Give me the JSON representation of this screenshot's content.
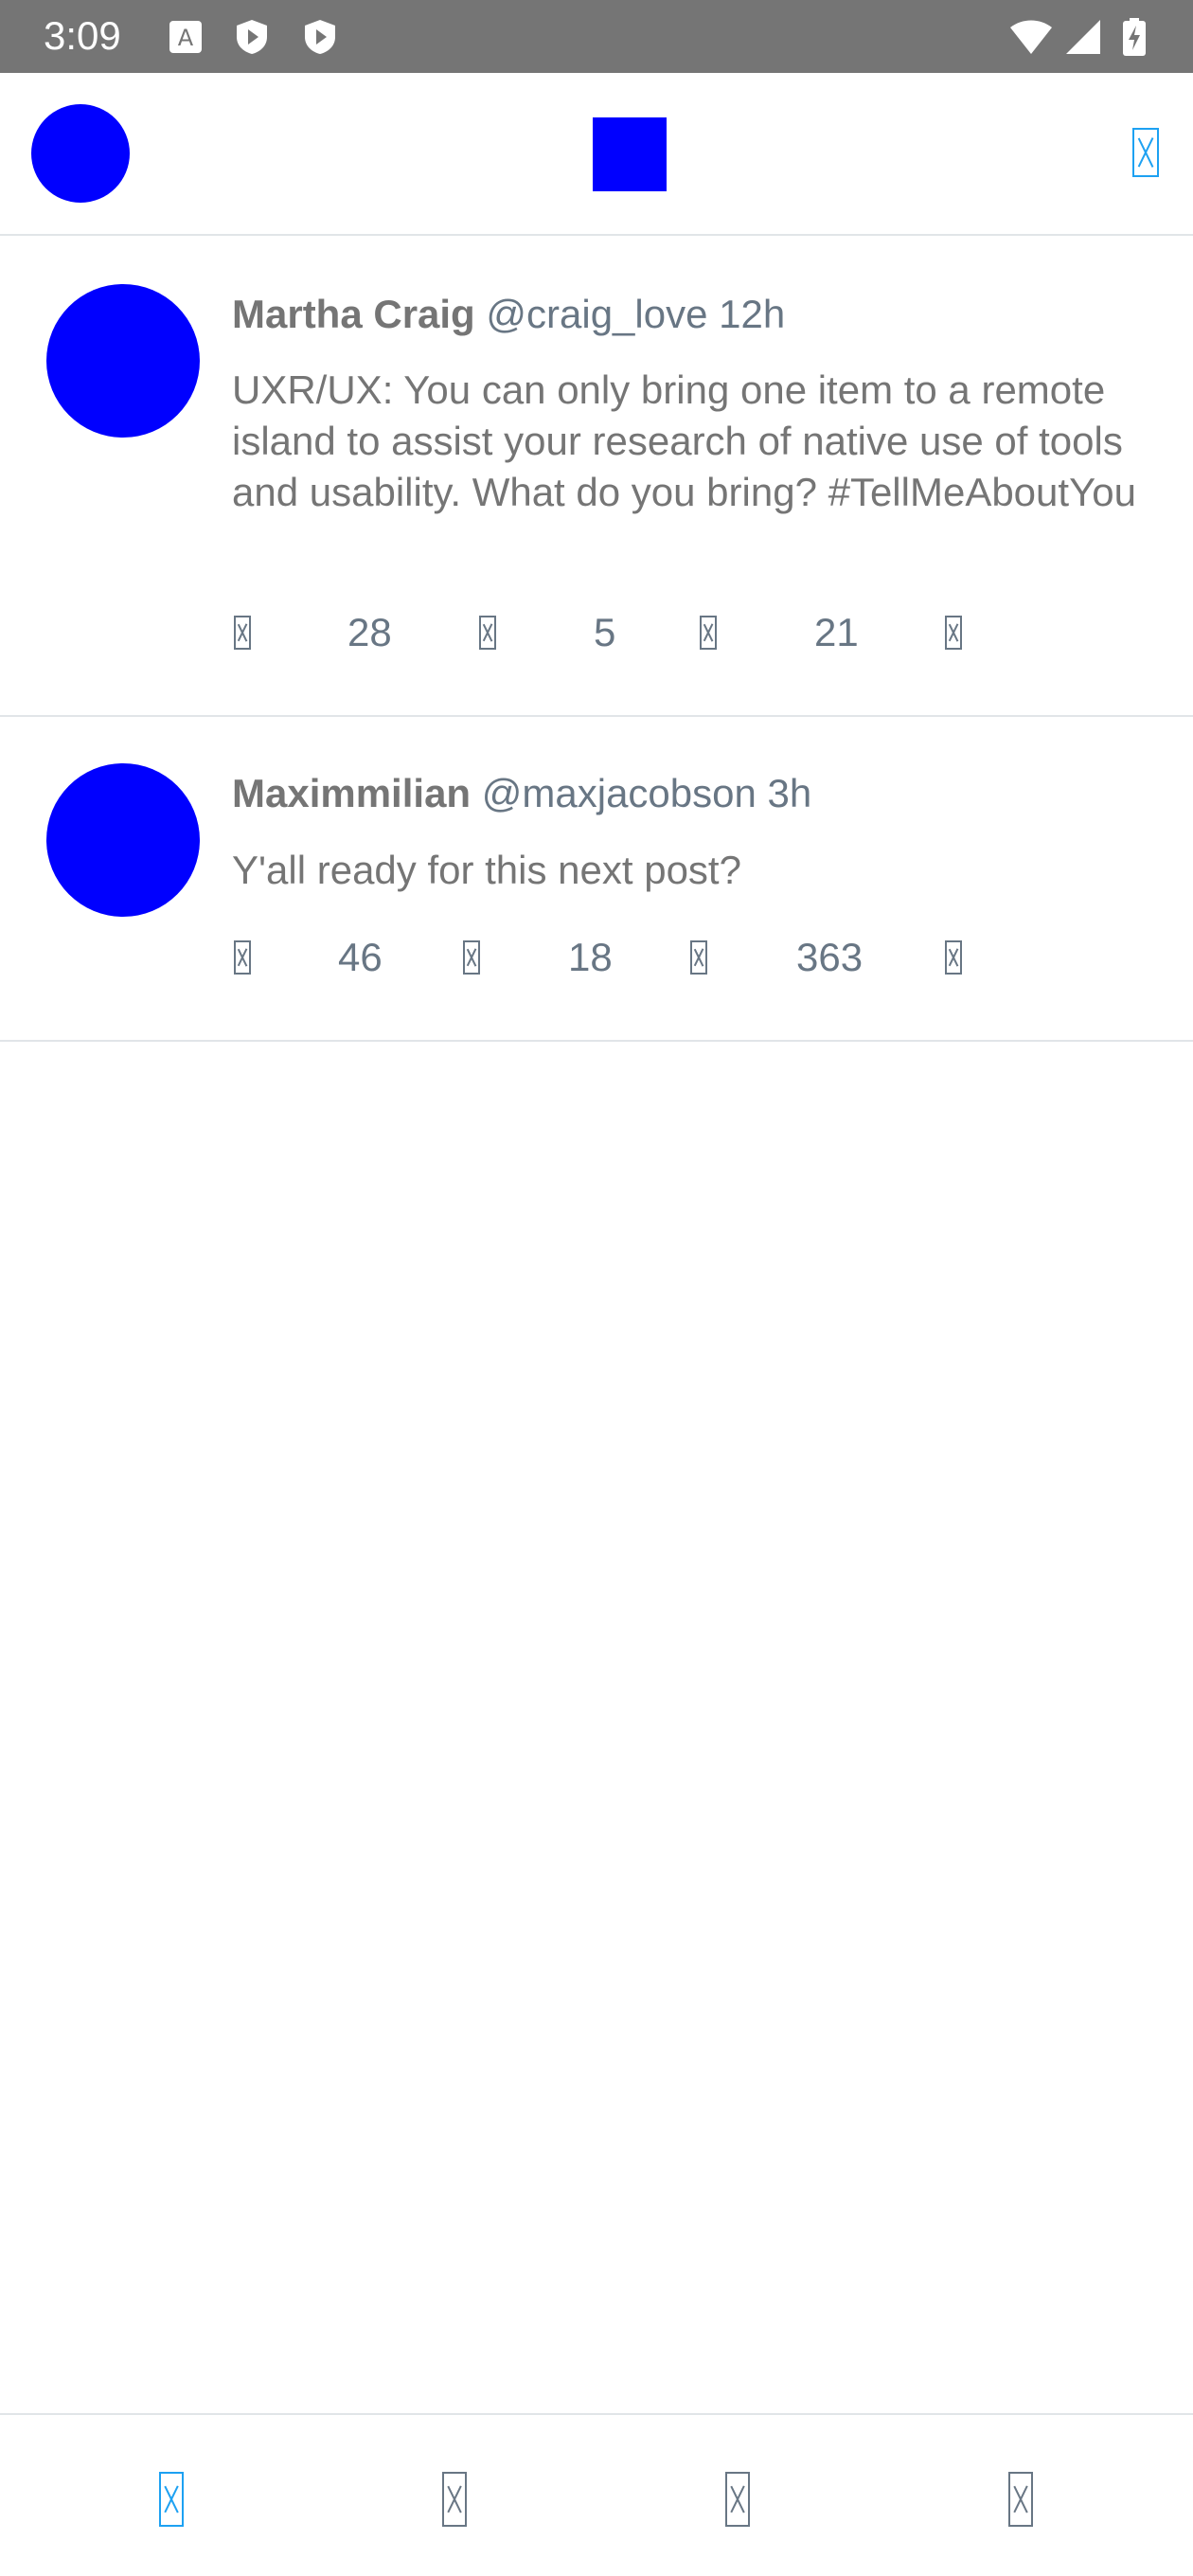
{
  "status_bar": {
    "time": "3:09"
  },
  "header": {
    "profile_avatar_color": "#0000ff",
    "logo_color": "#0000ff",
    "right_icon": "sparkle-icon",
    "accent_color": "#1da1f2"
  },
  "tweets": [
    {
      "author": "Martha Craig",
      "handle": "@craig_love",
      "time": "12h",
      "text": "UXR/UX: You can only bring one item to a remote island to assist your research of native use of tools and usability. What do you bring? #TellMeAboutYou",
      "replies": "28",
      "retweets": "5",
      "likes": "21"
    },
    {
      "author": "Maximmilian",
      "handle": "@maxjacobson",
      "time": "3h",
      "text": "Y'all ready for this next post?",
      "replies": "46",
      "retweets": "18",
      "likes": "363"
    }
  ],
  "bottom_nav": {
    "items": [
      "home-icon",
      "search-icon",
      "notifications-icon",
      "messages-icon"
    ],
    "active": "home-icon"
  }
}
